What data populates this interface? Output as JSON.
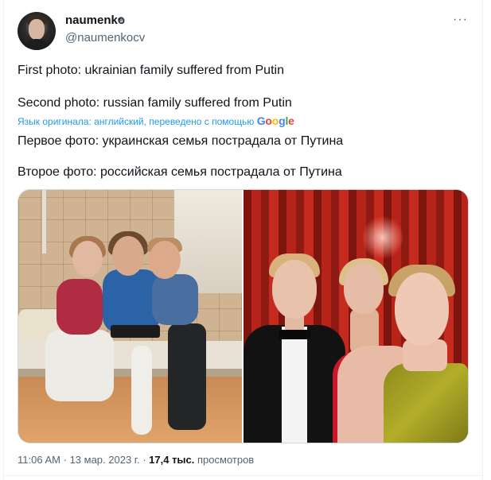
{
  "author": {
    "name": "naumenko",
    "badge": "⊕",
    "handle": "@naumenkocv"
  },
  "more_label": "···",
  "tweet": {
    "lines": [
      "First photo: ukrainian family suffered from Putin",
      "Second photo: russian family suffered from Putin",
      "Первое фото: украинская семья пострадала от Путина",
      "Второе фото: российская семья пострадала от Путина"
    ],
    "translation_notice": "Язык оригинала: английский, переведено с помощью",
    "translation_brand": [
      "G",
      "o",
      "o",
      "g",
      "l",
      "e"
    ]
  },
  "meta": {
    "time": "11:06 AM",
    "sep1": "·",
    "date": "13 мар. 2023 г.",
    "sep2": "·",
    "views_count": "17,4 тыс.",
    "views_label": "просмотров"
  },
  "colors": {
    "text_primary": "#0f1419",
    "text_secondary": "#536471",
    "link": "#1d9bf0",
    "border": "#cfd9de"
  }
}
